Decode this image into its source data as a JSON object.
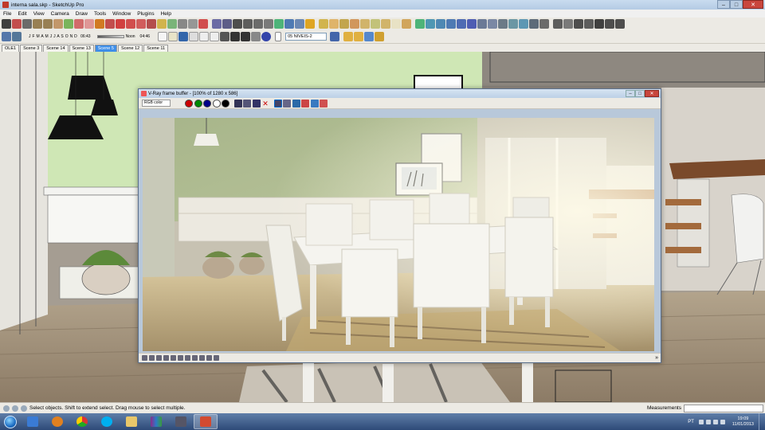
{
  "window": {
    "title": "interna sala.skp - SketchUp Pro",
    "minimize_glyph": "–",
    "maximize_glyph": "□",
    "close_glyph": "✕"
  },
  "menu": [
    "File",
    "Edit",
    "View",
    "Camera",
    "Draw",
    "Tools",
    "Window",
    "Plugins",
    "Help"
  ],
  "shadow_toolbar": {
    "months": "J F M A M J J A S O N D",
    "time_start": "06:43",
    "noon_label": "Noon",
    "time_end": "04:46",
    "layer": "05 NIVEIS-2"
  },
  "scene_tabs": [
    {
      "label": "OLE1",
      "active": false
    },
    {
      "label": "Scene 3",
      "active": false
    },
    {
      "label": "Scene 14",
      "active": false
    },
    {
      "label": "Scene 13",
      "active": false
    },
    {
      "label": "Scene 5",
      "active": true
    },
    {
      "label": "Scene 12",
      "active": false
    },
    {
      "label": "Scene 11",
      "active": false
    }
  ],
  "vray": {
    "title": "V-Ray frame buffer - [100% of 1280 x 586]",
    "channel": "RGB color",
    "minimize_glyph": "–",
    "maximize_glyph": "□",
    "close_glyph": "✕",
    "chevron_glyph": "»"
  },
  "status": {
    "message": "Select objects. Shift to extend select. Drag mouse to select multiple.",
    "measurements_label": "Measurements"
  },
  "tray": {
    "lang": "PT",
    "time": "19:09",
    "date": "11/01/2013"
  },
  "colors": {
    "wall_green": "#cfe7b5",
    "floor_wood": "#9a8a74",
    "taskbar": "#2e4a78",
    "active_tab": "#3e8ee8"
  }
}
